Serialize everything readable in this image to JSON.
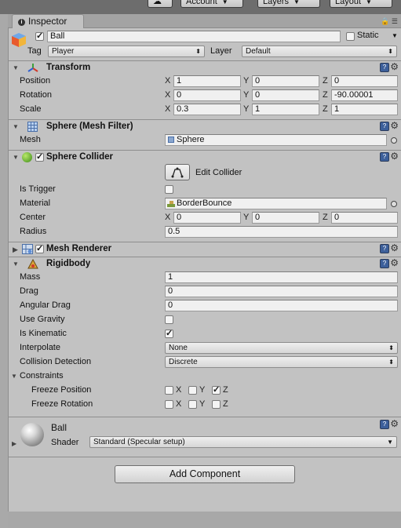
{
  "toolbar": {
    "cloud_icon": "cloud-icon",
    "account_label": "Account",
    "layers_label": "Layers",
    "layout_label": "Layout"
  },
  "tab": {
    "label": "Inspector"
  },
  "object": {
    "name": "Ball",
    "static_label": "Static",
    "tag_label": "Tag",
    "tag_value": "Player",
    "layer_label": "Layer",
    "layer_value": "Default"
  },
  "transform": {
    "title": "Transform",
    "position_label": "Position",
    "position": {
      "x": "1",
      "y": "0",
      "z": "0"
    },
    "rotation_label": "Rotation",
    "rotation": {
      "x": "0",
      "y": "0",
      "z": "-90.00001"
    },
    "scale_label": "Scale",
    "scale": {
      "x": "0.3",
      "y": "1",
      "z": "1"
    }
  },
  "axes": {
    "x": "X",
    "y": "Y",
    "z": "Z"
  },
  "mesh_filter": {
    "title": "Sphere (Mesh Filter)",
    "mesh_label": "Mesh",
    "mesh_value": "Sphere"
  },
  "sphere_collider": {
    "title": "Sphere Collider",
    "edit_label": "Edit Collider",
    "is_trigger_label": "Is Trigger",
    "is_trigger": false,
    "material_label": "Material",
    "material_value": "BorderBounce",
    "center_label": "Center",
    "center": {
      "x": "0",
      "y": "0",
      "z": "0"
    },
    "radius_label": "Radius",
    "radius_value": "0.5"
  },
  "mesh_renderer": {
    "title": "Mesh Renderer"
  },
  "rigidbody": {
    "title": "Rigidbody",
    "mass_label": "Mass",
    "mass": "1",
    "drag_label": "Drag",
    "drag": "0",
    "angular_drag_label": "Angular Drag",
    "angular_drag": "0",
    "use_gravity_label": "Use Gravity",
    "use_gravity": false,
    "is_kinematic_label": "Is Kinematic",
    "is_kinematic": true,
    "interpolate_label": "Interpolate",
    "interpolate": "None",
    "collision_label": "Collision Detection",
    "collision": "Discrete",
    "constraints_label": "Constraints",
    "freeze_position_label": "Freeze Position",
    "freeze_position": {
      "x": false,
      "y": false,
      "z": true
    },
    "freeze_rotation_label": "Freeze Rotation",
    "freeze_rotation": {
      "x": false,
      "y": false,
      "z": false
    }
  },
  "material": {
    "name": "Ball",
    "shader_label": "Shader",
    "shader_value": "Standard (Specular setup)"
  },
  "add_component_label": "Add Component",
  "colors": {
    "panel": "#c2c2c2",
    "help_icon": "#3c5f9a",
    "checkbox_border": "#7a7a7a"
  }
}
